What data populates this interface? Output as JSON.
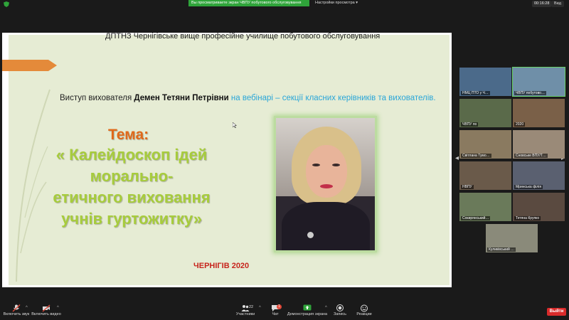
{
  "topbar": {
    "share_banner": "Вы просматриваете экран ЧВПУ побутового обслуговування",
    "view_options": "Настройки просмотра",
    "view_button": "Вид",
    "timer": "00:16:28"
  },
  "slide": {
    "header": "ДПТНЗ Чернігівське вище професійне училище побутового обслуговування",
    "speech_prefix": "Виступ вихователя ",
    "speech_name": "Демен Тетяни Петрівни",
    "speech_suffix": " на вебінарі – секції класних керівників та вихователів.",
    "theme_label": "Тема",
    "theme_colon": ":",
    "theme_lines": [
      "« Калейдоскоп ідей",
      "морально-",
      "етичного виховання",
      "учнів гуртожитку»"
    ],
    "city": "ЧЕРНІГІВ 2020"
  },
  "participants": [
    {
      "name": "НМЦ ПТО у Ч…",
      "color": "#4b6a8a"
    },
    {
      "name": "ЧВПУ побутово…",
      "color": "#6f8fa8"
    },
    {
      "name": "ЧВПУ по",
      "color": "#5a6a4a"
    },
    {
      "name": "2020",
      "color": "#7a6048"
    },
    {
      "name": "Світлана Тумо…",
      "color": "#8a7a60"
    },
    {
      "name": "Сновське ВПУ/Т…",
      "color": "#9a8a78"
    },
    {
      "name": "НВПУ",
      "color": "#6a5a4a"
    },
    {
      "name": "Мринська філія",
      "color": "#5a6070"
    },
    {
      "name": "Сокирянський…",
      "color": "#6a7a5a"
    },
    {
      "name": "Тетяна Крупко",
      "color": "#5a4a40"
    },
    {
      "name": "Куликівський …",
      "color": "#8a8a7a"
    }
  ],
  "bottombar": {
    "mute": "Включить звук",
    "video": "Включить видео",
    "participants": "Участники",
    "participants_count": "22",
    "chat": "Чат",
    "chat_badge": "1",
    "share": "Демонстрация экрана",
    "record": "Запись",
    "reactions": "Реакции",
    "leave": "Выйти"
  },
  "colors": {
    "accent_green": "#2fa43a",
    "leave_red": "#d92b2b",
    "theme_orange": "#e0691a",
    "title_green": "#a7cc3c",
    "blue_text": "#2aa6d8"
  }
}
